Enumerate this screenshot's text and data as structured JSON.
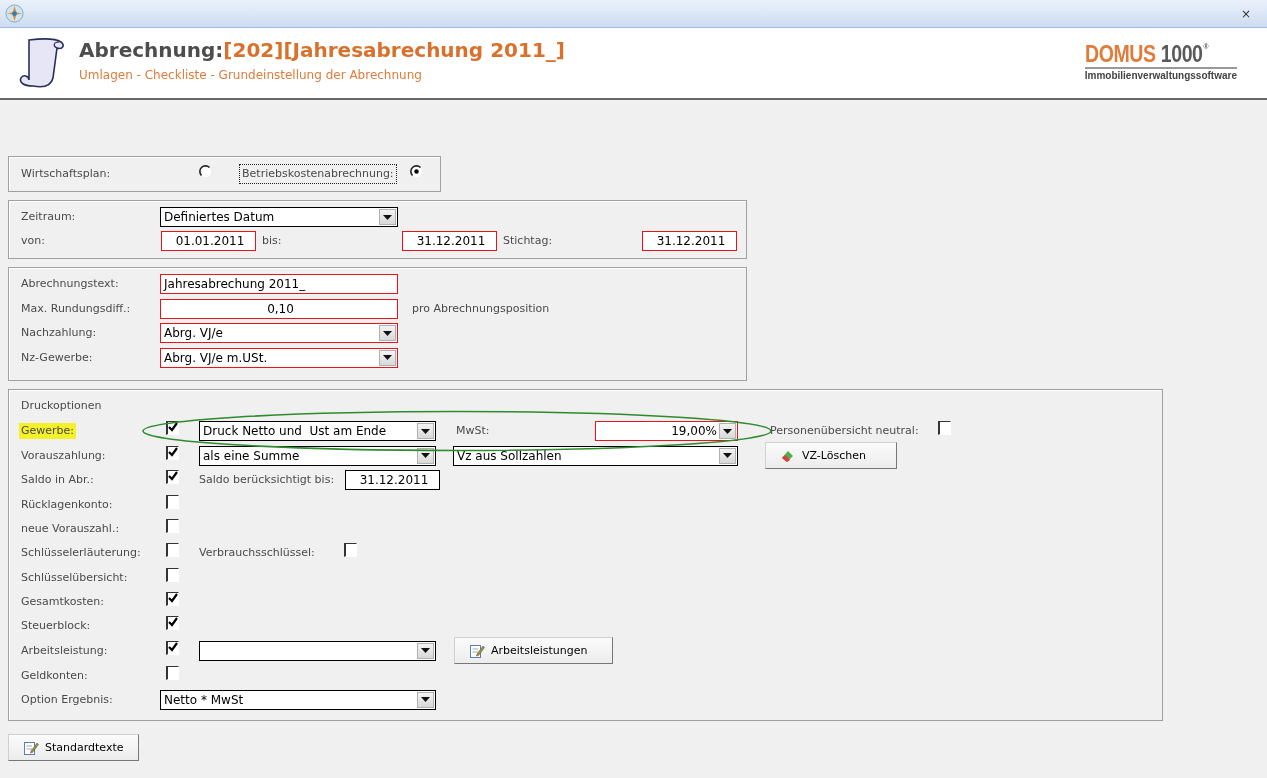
{
  "window": {
    "close": "×"
  },
  "header": {
    "title": "Abrechnung:",
    "reference": "[202][Jahresabrechung 2011_]",
    "subtitle": "Umlagen - Checkliste - Grundeinstellung der Abrechnung",
    "logo": {
      "brand": "DOMUS",
      "number": "1000",
      "registered": "®",
      "tagline": "Immobilienverwaltungssoftware"
    }
  },
  "mode_options": [
    {
      "label": "Wirtschaftsplan:",
      "selected": false,
      "focused": false
    },
    {
      "label": "Betriebskostenabrechnung:",
      "selected": true,
      "focused": true
    }
  ],
  "period": {
    "label": "Zeitraum:",
    "value": "Definiertes Datum",
    "invalid": false,
    "dates": [
      {
        "label": "von:",
        "value": "01.01.2011",
        "invalid": true
      },
      {
        "label": "bis:",
        "value": "31.12.2011",
        "invalid": true
      },
      {
        "label": "Stichtag:",
        "value": "31.12.2011",
        "invalid": true
      }
    ]
  },
  "settings": [
    {
      "kind": "text",
      "label": "Abrechnungstext:",
      "value": "Jahresabrechung 2011_",
      "invalid": true
    },
    {
      "kind": "number",
      "label": "Max. Rundungsdiff.:",
      "value": "0,10",
      "invalid": true,
      "hint": "pro Abrechnungsposition"
    },
    {
      "kind": "dropdown",
      "label": "Nachzahlung:",
      "value": "Abrg. VJ/e",
      "invalid": true
    },
    {
      "kind": "dropdown",
      "label": "Nz-Gewerbe:",
      "value": "Abrg. VJ/e m.USt.",
      "invalid": true
    }
  ],
  "print_options": {
    "title": "Druckoptionen",
    "rows": [
      {
        "kind": "check",
        "label": "Gewerbe:",
        "highlighted": true,
        "checked": true,
        "extras": [
          {
            "kind": "dropdown",
            "value": "Druck Netto und  Ust am Ende",
            "invalid": false
          },
          {
            "kind": "label",
            "text": "MwSt:"
          },
          {
            "kind": "amount",
            "value": "19,00%",
            "invalid": true
          },
          {
            "kind": "label",
            "text": "Personenübersicht neutral:"
          },
          {
            "kind": "checkbox",
            "checked": false
          }
        ]
      },
      {
        "kind": "check",
        "label": "Vorauszahlung:",
        "highlighted": false,
        "checked": true,
        "extras": [
          {
            "kind": "dropdown",
            "value": "als eine Summe",
            "invalid": false
          },
          {
            "kind": "dropdown",
            "value": "Vz aus Sollzahlen",
            "invalid": false
          },
          {
            "kind": "button",
            "label": "VZ-Löschen"
          }
        ]
      },
      {
        "kind": "check",
        "label": "Saldo in Abr.:",
        "highlighted": false,
        "checked": true,
        "extras": [
          {
            "kind": "label",
            "text": "Saldo berücksichtigt bis:"
          },
          {
            "kind": "field",
            "value": "31.12.2011",
            "invalid": false
          }
        ]
      },
      {
        "kind": "check",
        "label": "Rücklagenkonto:",
        "highlighted": false,
        "checked": false
      },
      {
        "kind": "check",
        "label": "neue Vorauszahl.:",
        "highlighted": false,
        "checked": false
      },
      {
        "kind": "check",
        "label": "Schlüsselerläuterung:",
        "highlighted": false,
        "checked": false,
        "extras": [
          {
            "kind": "label",
            "text": "Verbrauchsschlüssel:"
          },
          {
            "kind": "checkbox",
            "checked": false
          }
        ]
      },
      {
        "kind": "check",
        "label": "Schlüsselübersicht:",
        "highlighted": false,
        "checked": false
      },
      {
        "kind": "check",
        "label": "Gesamtkosten:",
        "highlighted": false,
        "checked": true
      },
      {
        "kind": "check",
        "label": "Steuerblock:",
        "highlighted": false,
        "checked": true
      },
      {
        "kind": "check",
        "label": "Arbeitsleistung:",
        "highlighted": false,
        "checked": true,
        "extras": [
          {
            "kind": "dropdown",
            "invalid": false
          },
          {
            "kind": "button",
            "label": "Arbeitsleistungen"
          }
        ]
      },
      {
        "kind": "check",
        "label": "Geldkonten:",
        "highlighted": false,
        "checked": false
      },
      {
        "kind": "select",
        "label": "Option Ergebnis:",
        "highlighted": false,
        "extras": [
          {
            "kind": "dropdown",
            "value": "Netto * MwSt",
            "invalid": false
          }
        ]
      }
    ]
  },
  "footer_button": {
    "label": "Standardtexte"
  }
}
